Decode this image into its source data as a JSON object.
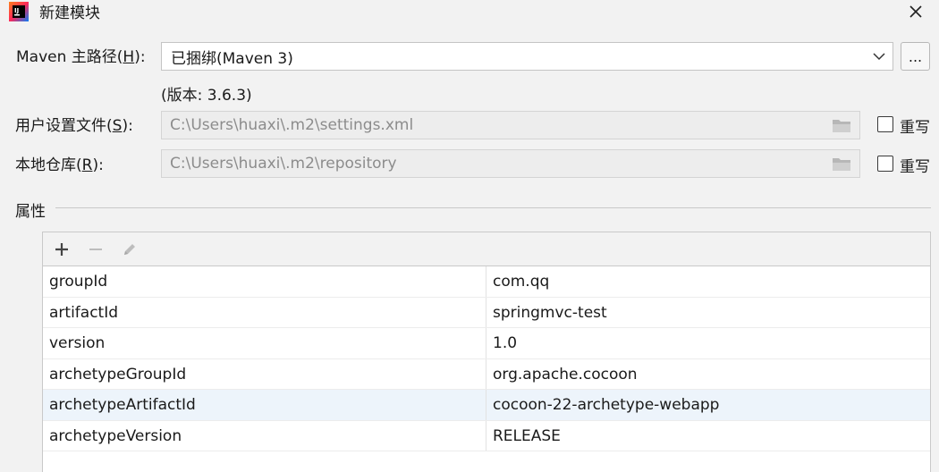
{
  "window": {
    "title": "新建模块",
    "icon": "intellij-idea-icon",
    "close_icon": "close-icon"
  },
  "maven_home": {
    "label_prefix": "Maven 主路径(",
    "label_mnemonic": "H",
    "label_suffix": "):",
    "value": "已捆绑(Maven 3)",
    "browse_label": "...",
    "version_text": "(版本: 3.6.3)"
  },
  "settings_file": {
    "label_prefix": "用户设置文件(",
    "label_mnemonic": "S",
    "label_suffix": "):",
    "value": "C:\\Users\\huaxi\\.m2\\settings.xml",
    "override_label": "重写",
    "override_checked": false
  },
  "local_repo": {
    "label_prefix": "本地仓库(",
    "label_mnemonic": "R",
    "label_suffix": "):",
    "value": "C:\\Users\\huaxi\\.m2\\repository",
    "override_label": "重写",
    "override_checked": false
  },
  "properties": {
    "title": "属性",
    "toolbar": [
      "add-icon",
      "remove-icon",
      "edit-icon"
    ],
    "rows": [
      {
        "key": "groupId",
        "value": "com.qq"
      },
      {
        "key": "artifactId",
        "value": "springmvc-test"
      },
      {
        "key": "version",
        "value": "1.0"
      },
      {
        "key": "archetypeGroupId",
        "value": "org.apache.cocoon"
      },
      {
        "key": "archetypeArtifactId",
        "value": "cocoon-22-archetype-webapp",
        "selected": true
      },
      {
        "key": "archetypeVersion",
        "value": "RELEASE"
      }
    ]
  },
  "colors": {
    "selected_row": "#edf4fb",
    "background": "#f2f2f2"
  }
}
